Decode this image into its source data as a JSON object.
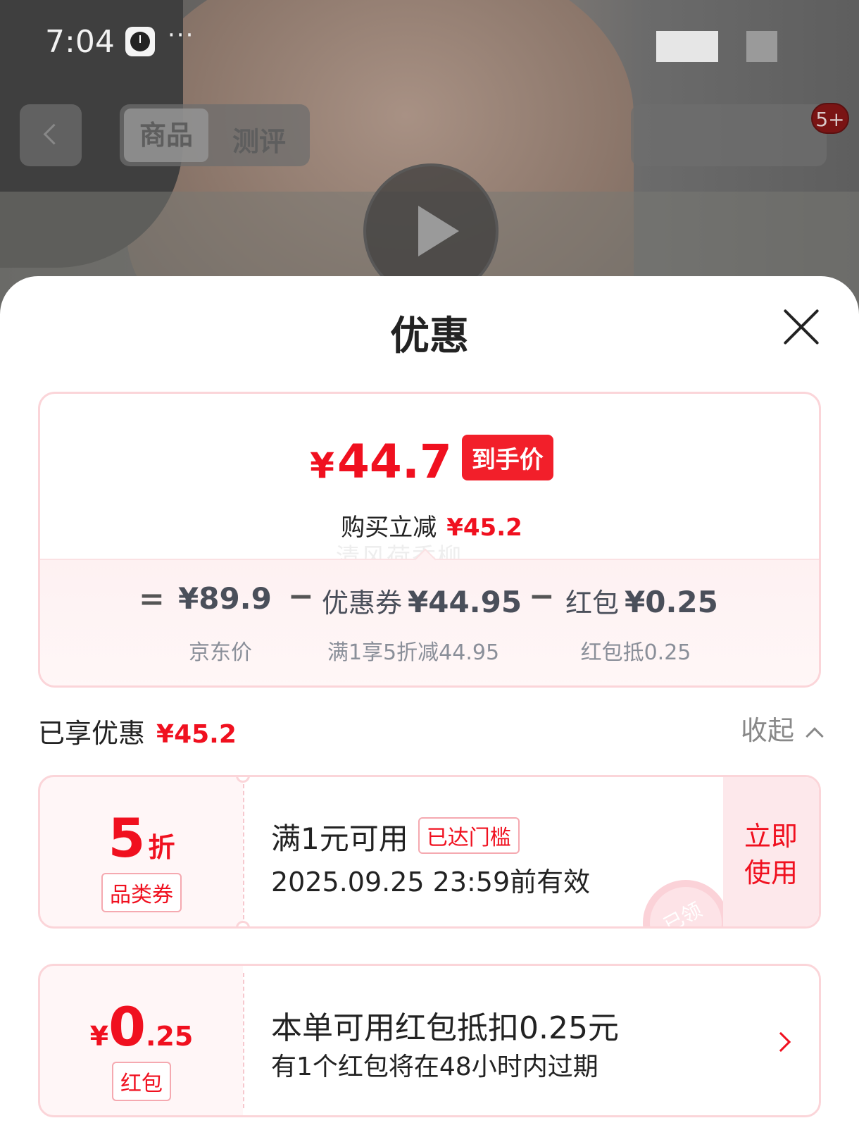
{
  "status_bar": {
    "time": "7:04",
    "more": "···"
  },
  "background_nav": {
    "tabs": [
      {
        "label": "商品"
      },
      {
        "label": "测评"
      }
    ],
    "cart_badge": "5+"
  },
  "sheet": {
    "title": "优惠",
    "summary": {
      "final_price_symbol": "¥",
      "final_price": "44.7",
      "final_price_tag": "到手价",
      "reduce_label": "购买立减",
      "reduce_amount": "¥45.2",
      "watermark": "清风荷香柳"
    },
    "breakdown": {
      "equals": "=",
      "minus": "−",
      "items": [
        {
          "label": "",
          "value": "¥89.9",
          "sub": "京东价"
        },
        {
          "label": "优惠券",
          "value": "¥44.95",
          "sub": "满1享5折减44.95"
        },
        {
          "label": "红包",
          "value": "¥0.25",
          "sub": "红包抵0.25"
        }
      ]
    },
    "enjoyed": {
      "label": "已享优惠",
      "amount": "¥45.2",
      "collapse_label": "收起"
    },
    "coupons": [
      {
        "value": "5",
        "unit": "折",
        "type": "品类券",
        "condition": "满1元可用",
        "reached_tag": "已达门槛",
        "expiry": "2025.09.25 23:59前有效",
        "action_line1": "立即",
        "action_line2": "使用",
        "stamp": "已领"
      },
      {
        "currency": "¥",
        "value": "0",
        "decimal": ".25",
        "type": "红包",
        "title": "本单可用红包抵扣0.25元",
        "subtitle": "有1个红包将在48小时内过期"
      }
    ]
  },
  "colors": {
    "accent_red": "#f0101f",
    "card_border": "#fbd5d9",
    "card_bg": "#fff6f7"
  }
}
